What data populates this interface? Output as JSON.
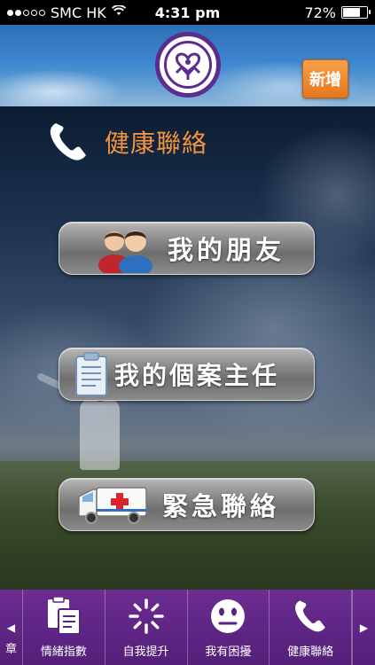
{
  "status_bar": {
    "carrier": "SMC HK",
    "time": "4:31 pm",
    "battery": "72%",
    "battery_level": 0.72
  },
  "header": {
    "add_label": "新增"
  },
  "section": {
    "title": "健康聯絡",
    "icon": "phone-icon"
  },
  "menu": {
    "friends": "我的朋友",
    "case_manager": "我的個案主任",
    "emergency": "緊急聯絡"
  },
  "tabbar": {
    "tabs": [
      {
        "label": "情緒指數",
        "icon": "clipboard-icon"
      },
      {
        "label": "自我提升",
        "icon": "spinner-icon"
      },
      {
        "label": "我有困擾",
        "icon": "neutral-face-icon"
      },
      {
        "label": "健康聯絡",
        "icon": "phone-icon"
      }
    ],
    "left_partial": "章"
  },
  "colors": {
    "accent_orange": "#f3943a",
    "tabbar_purple": "#5b2389",
    "logo_purple": "#5b2d8e"
  }
}
